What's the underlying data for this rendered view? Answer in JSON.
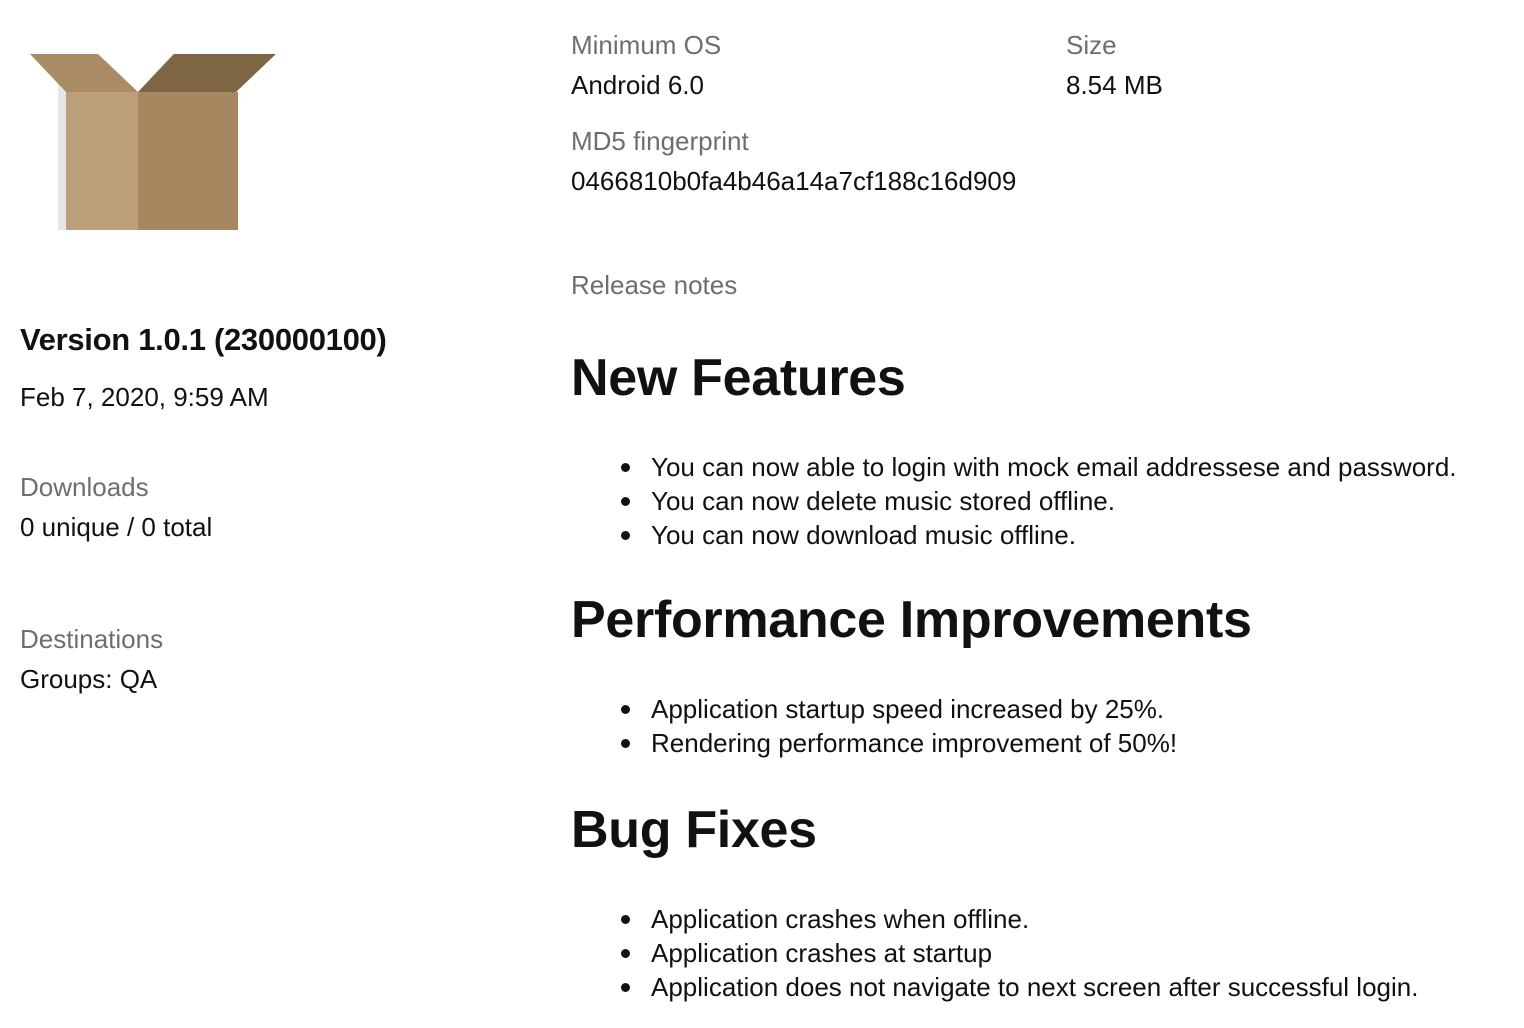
{
  "icon": "package-box-icon",
  "release": {
    "version_title": "Version 1.0.1 (230000100)",
    "date": "Feb 7, 2020, 9:59 AM"
  },
  "downloads": {
    "label": "Downloads",
    "value": "0 unique / 0 total"
  },
  "destinations": {
    "label": "Destinations",
    "value": "Groups: QA"
  },
  "minimum_os": {
    "label": "Minimum OS",
    "value": "Android 6.0"
  },
  "size": {
    "label": "Size",
    "value": "8.54 MB"
  },
  "md5": {
    "label": "MD5 fingerprint",
    "value": "0466810b0fa4b46a14a7cf188c16d909"
  },
  "release_notes": {
    "label": "Release notes",
    "sections": [
      {
        "heading": "New Features",
        "items": [
          "You can now able to login with mock email addressese and password.",
          "You can now delete music stored offline.",
          "You can now download music offline."
        ]
      },
      {
        "heading": "Performance Improvements",
        "items": [
          "Application startup speed increased by 25%.",
          "Rendering performance improvement of 50%!"
        ]
      },
      {
        "heading": "Bug Fixes",
        "items": [
          "Application crashes when offline.",
          "Application crashes at startup",
          "Application does not navigate to next screen after successful login."
        ]
      }
    ]
  },
  "colors": {
    "label_gray": "#6e6e6e",
    "text": "#111111",
    "box_light": "#bba07b",
    "box_dark": "#a6875f",
    "box_flap_dark": "#7e6543"
  }
}
